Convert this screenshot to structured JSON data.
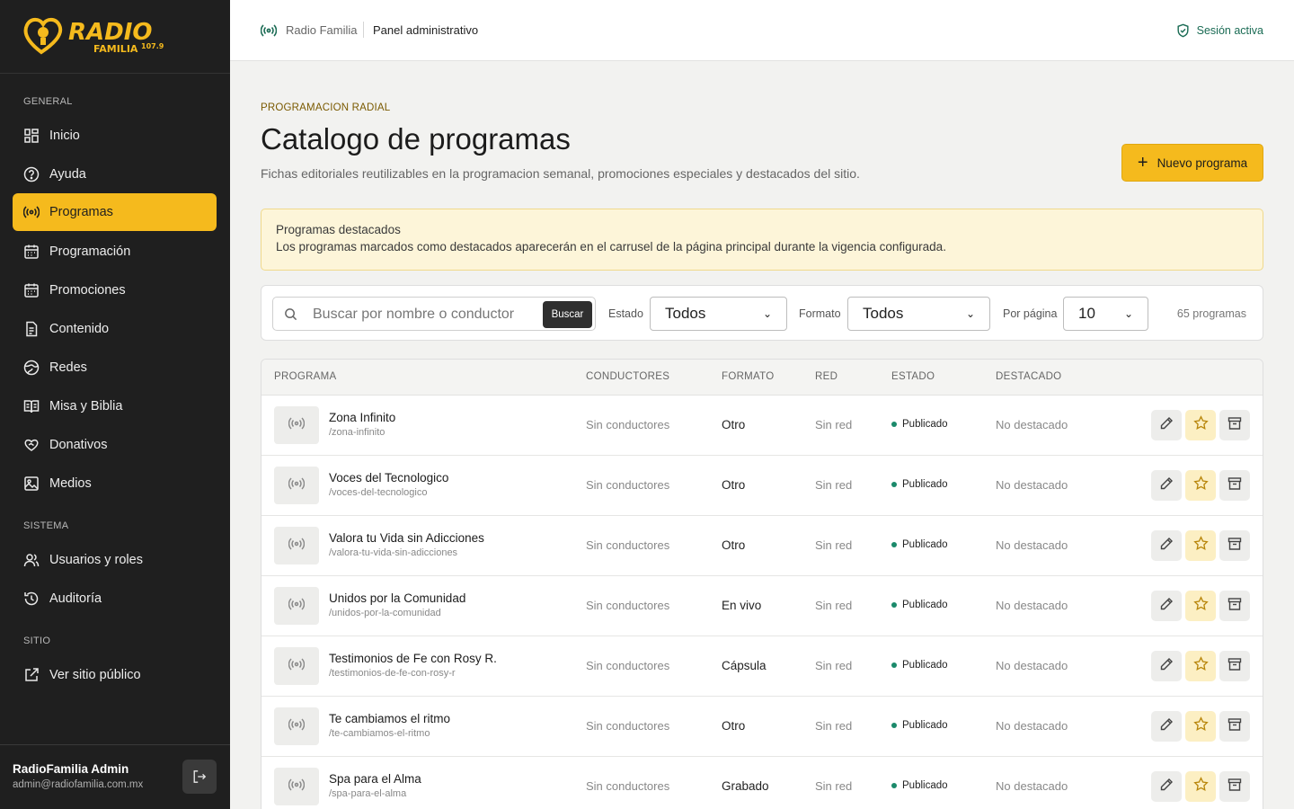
{
  "brand": {
    "logo_text": "RADIO",
    "logo_sub": "FAMILIA",
    "logo_freq": "107.9"
  },
  "sidebar": {
    "sections": [
      "GENERAL",
      "SISTEMA",
      "SITIO"
    ],
    "general": [
      {
        "label": "Inicio",
        "icon": "grid-icon"
      },
      {
        "label": "Ayuda",
        "icon": "help-circle-icon"
      },
      {
        "label": "Programas",
        "icon": "broadcast-icon",
        "active": true
      },
      {
        "label": "Programación",
        "icon": "calendar-icon"
      },
      {
        "label": "Promociones",
        "icon": "calendar-icon"
      },
      {
        "label": "Contenido",
        "icon": "document-icon"
      },
      {
        "label": "Redes",
        "icon": "globe-icon"
      },
      {
        "label": "Misa y Biblia",
        "icon": "book-icon"
      },
      {
        "label": "Donativos",
        "icon": "heart-hand-icon"
      },
      {
        "label": "Medios",
        "icon": "image-icon"
      }
    ],
    "sistema": [
      {
        "label": "Usuarios y roles",
        "icon": "users-icon"
      },
      {
        "label": "Auditoría",
        "icon": "history-icon"
      }
    ],
    "sitio": [
      {
        "label": "Ver sitio público",
        "icon": "external-link-icon"
      }
    ],
    "user": {
      "name": "RadioFamilia Admin",
      "email": "admin@radiofamilia.com.mx"
    }
  },
  "topbar": {
    "crumb1": "Radio Familia",
    "crumb2": "Panel administrativo",
    "session": "Sesión activa"
  },
  "header": {
    "eyebrow": "PROGRAMACION RADIAL",
    "title": "Catalogo de programas",
    "subtitle": "Fichas editoriales reutilizables en la programacion semanal, promociones especiales y destacados del sitio.",
    "new_button": "Nuevo programa"
  },
  "notice": {
    "title": "Programas destacados",
    "text": "Los programas marcados como destacados aparecerán en el carrusel de la página principal durante la vigencia configurada."
  },
  "filters": {
    "search_placeholder": "Buscar por nombre o conductor",
    "search_button": "Buscar",
    "estado_label": "Estado",
    "estado_value": "Todos",
    "formato_label": "Formato",
    "formato_value": "Todos",
    "per_page_label": "Por página",
    "per_page_value": "10",
    "count": "65 programas"
  },
  "table": {
    "headers": [
      "PROGRAMA",
      "CONDUCTORES",
      "FORMATO",
      "RED",
      "ESTADO",
      "DESTACADO"
    ],
    "rows": [
      {
        "name": "Zona Infinito",
        "slug": "/zona-infinito",
        "hosts": "Sin conductores",
        "format": "Otro",
        "network": "Sin red",
        "status": "Publicado",
        "featured": "No destacado"
      },
      {
        "name": "Voces del Tecnologico",
        "slug": "/voces-del-tecnologico",
        "hosts": "Sin conductores",
        "format": "Otro",
        "network": "Sin red",
        "status": "Publicado",
        "featured": "No destacado"
      },
      {
        "name": "Valora tu Vida sin Adicciones",
        "slug": "/valora-tu-vida-sin-adicciones",
        "hosts": "Sin conductores",
        "format": "Otro",
        "network": "Sin red",
        "status": "Publicado",
        "featured": "No destacado"
      },
      {
        "name": "Unidos por la Comunidad",
        "slug": "/unidos-por-la-comunidad",
        "hosts": "Sin conductores",
        "format": "En vivo",
        "network": "Sin red",
        "status": "Publicado",
        "featured": "No destacado"
      },
      {
        "name": "Testimonios de Fe con Rosy R.",
        "slug": "/testimonios-de-fe-con-rosy-r",
        "hosts": "Sin conductores",
        "format": "Cápsula",
        "network": "Sin red",
        "status": "Publicado",
        "featured": "No destacado"
      },
      {
        "name": "Te cambiamos el ritmo",
        "slug": "/te-cambiamos-el-ritmo",
        "hosts": "Sin conductores",
        "format": "Otro",
        "network": "Sin red",
        "status": "Publicado",
        "featured": "No destacado"
      },
      {
        "name": "Spa para el Alma",
        "slug": "/spa-para-el-alma",
        "hosts": "Sin conductores",
        "format": "Grabado",
        "network": "Sin red",
        "status": "Publicado",
        "featured": "No destacado"
      }
    ]
  },
  "colors": {
    "accent": "#f5ba1d",
    "sidebar_bg": "#1f1f1f",
    "status_green": "#1b8a6b",
    "session_green": "#1a6b54"
  }
}
